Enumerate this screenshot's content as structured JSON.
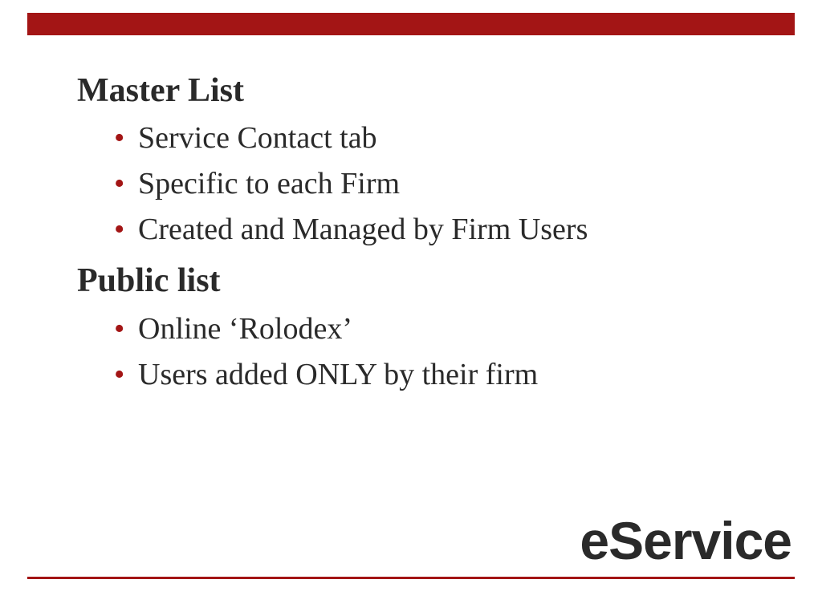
{
  "sections": [
    {
      "heading": "Master List",
      "items": [
        "Service Contact tab",
        "Specific to each Firm",
        "Created and Managed by Firm Users"
      ]
    },
    {
      "heading": "Public list",
      "items": [
        "Online ‘Rolodex’",
        "Users added ONLY by their firm"
      ]
    }
  ],
  "footer_title": "eService",
  "colors": {
    "accent": "#a31515",
    "text": "#2a2a2a"
  }
}
